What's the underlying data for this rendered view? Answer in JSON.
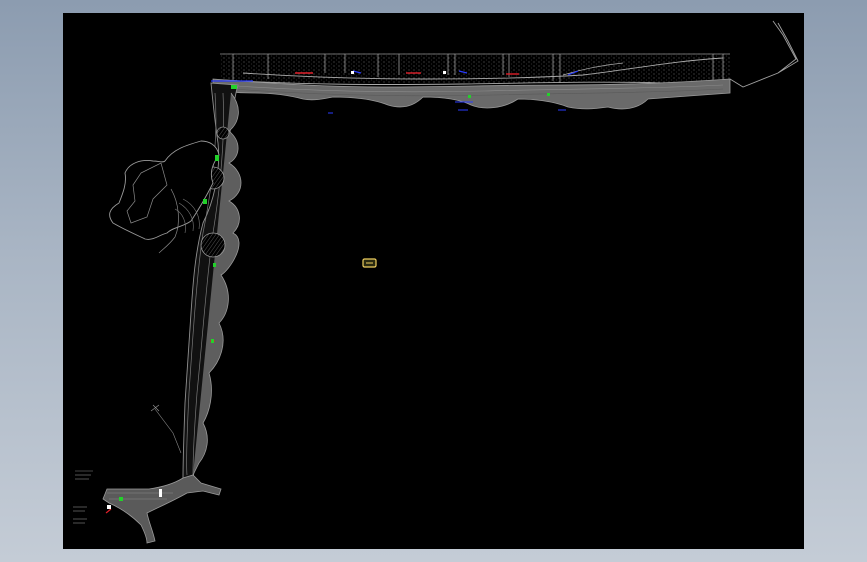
{
  "viewport": {
    "background": "#000000",
    "line_color": "#8f8f8f",
    "annotation_colors": {
      "blue": "#2a3cff",
      "red": "#e0202a",
      "green": "#22d22a",
      "white": "#ffffff",
      "yellow": "#f0d060"
    }
  },
  "annotations": {
    "top_labels": [
      "",
      "",
      "",
      ""
    ],
    "bottom_left_labels": [
      "",
      "",
      ""
    ]
  }
}
